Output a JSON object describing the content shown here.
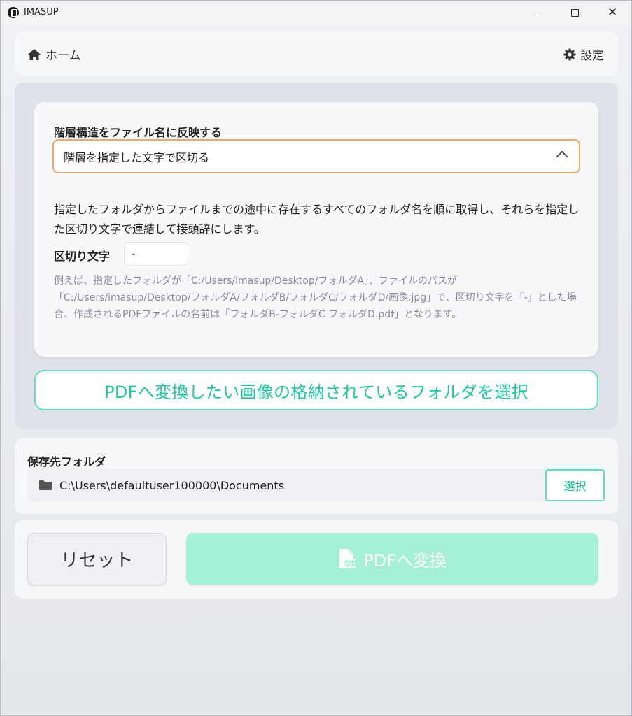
{
  "window": {
    "title": "IMASUP",
    "controls": {
      "minimize": "",
      "maximize": "",
      "close": "✕"
    }
  },
  "nav": {
    "home_label": "ホーム",
    "settings_label": "設定"
  },
  "prefix": {
    "label": "階層構造をファイル名に反映する",
    "selected_option": "階層を指定した文字で区切る",
    "description": "指定したフォルダからファイルまでの途中に存在するすべてのフォルダ名を順に取得し、それらを指定した区切り文字で連結して接頭辞にします。",
    "separator_label": "区切り文字",
    "separator_value": "-",
    "example": "例えば、指定したフォルダが「C:/Users/imasup/Desktop/フォルダA」、ファイルのパスが「C:/Users/imasup/Desktop/フォルダA/フォルダB/フォルダC/フォルダD/画像.jpg」で、区切り文字を「-」とした場合、作成されるPDFファイルの名前は「フォルダB-フォルダC フォルダD.pdf」となります。"
  },
  "select_folder_button": "PDFへ変換したい画像の格納されているフォルダを選択",
  "save": {
    "label": "保存先フォルダ",
    "path": "C:\\Users\\defaultuser100000\\Documents",
    "select_button": "選択"
  },
  "actions": {
    "reset_label": "リセット",
    "convert_label": "PDFへ変換"
  },
  "colors": {
    "accent": "#22c8a0",
    "accent_border": "#5fe0ba",
    "convert_bg": "#a6f0d5",
    "select_border": "#f5a962"
  },
  "icons": {
    "home": "home-icon",
    "settings": "gear-icon",
    "folder": "folder-icon",
    "pdf": "pdf-file-icon",
    "chevron": "chevron-up-icon"
  }
}
